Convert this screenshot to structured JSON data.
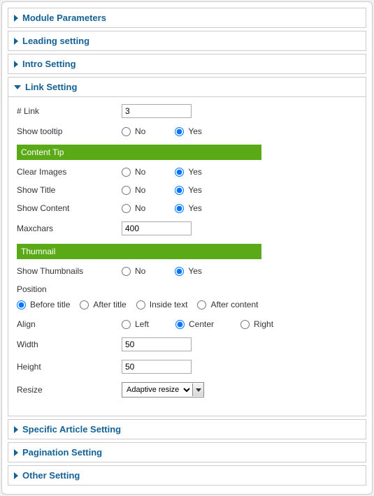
{
  "sections": {
    "module_parameters": "Module Parameters",
    "leading_setting": "Leading setting",
    "intro_setting": "Intro Setting",
    "link_setting": "Link Setting",
    "specific_article_setting": "Specific Article Setting",
    "pagination_setting": "Pagination Setting",
    "other_setting": "Other Setting"
  },
  "link": {
    "num_label": "# Link",
    "num_value": "3",
    "show_tooltip_label": "Show tooltip",
    "show_tooltip": "Yes",
    "content_tip_header": "Content Tip",
    "clear_images_label": "Clear Images",
    "clear_images": "Yes",
    "show_title_label": "Show Title",
    "show_title": "Yes",
    "show_content_label": "Show Content",
    "show_content": "Yes",
    "maxchars_label": "Maxchars",
    "maxchars_value": "400",
    "thumbnail_header": "Thumnail",
    "show_thumbnails_label": "Show Thumbnails",
    "show_thumbnails": "Yes",
    "position_label": "Position",
    "position": "Before title",
    "position_options": {
      "before": "Before title",
      "after": "After title",
      "inside": "Inside text",
      "after_content": "After content"
    },
    "align_label": "Align",
    "align": "Center",
    "align_options": {
      "left": "Left",
      "center": "Center",
      "right": "Right"
    },
    "width_label": "Width",
    "width_value": "50",
    "height_label": "Height",
    "height_value": "50",
    "resize_label": "Resize",
    "resize_value": "Adaptive resize"
  },
  "common": {
    "no": "No",
    "yes": "Yes"
  }
}
